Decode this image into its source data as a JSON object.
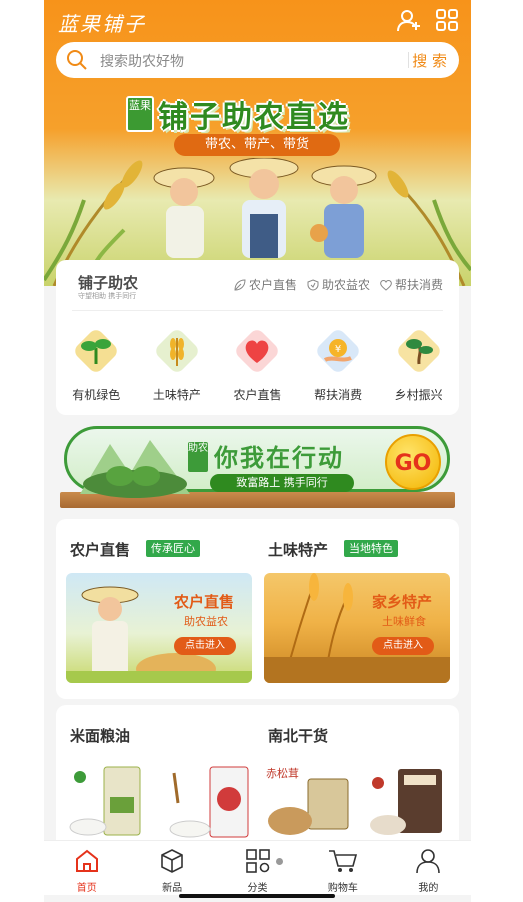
{
  "header": {
    "brand": "蓝果铺子",
    "icons": [
      "user-add-icon",
      "grid-icon"
    ]
  },
  "search": {
    "placeholder": "搜索助农好物",
    "button": "搜 索"
  },
  "banner": {
    "badge": "蓝果",
    "title": "铺子助农直选",
    "subtitle": "带农、带产、带货"
  },
  "intro": {
    "title": "铺子助农",
    "subtitle": "守望相助 携手同行",
    "tags": [
      "农户直售",
      "助农益农",
      "帮扶消费"
    ],
    "categories": [
      {
        "label": "有机绿色",
        "icon": "seedling-icon"
      },
      {
        "label": "土味特产",
        "icon": "wheat-icon"
      },
      {
        "label": "农户直售",
        "icon": "heart-icon"
      },
      {
        "label": "帮扶消费",
        "icon": "coin-icon"
      },
      {
        "label": "乡村振兴",
        "icon": "bonsai-icon"
      }
    ]
  },
  "promo": {
    "badge": "助农",
    "title": "你我在行动",
    "subtitle": "致富路上 携手同行",
    "go": "GO"
  },
  "sections": {
    "direct": {
      "title": "农户直售",
      "badge": "传承匠心",
      "card_title": "农户直售",
      "card_sub": "助农益农",
      "card_btn": "点击进入"
    },
    "local": {
      "title": "土味特产",
      "badge": "当地特色",
      "card_title": "家乡特产",
      "card_sub": "土味鲜食",
      "card_btn": "点击进入"
    },
    "grain": {
      "title": "米面粮油"
    },
    "dry": {
      "title": "南北干货"
    }
  },
  "tabbar": [
    {
      "label": "首页",
      "icon": "home-icon",
      "active": true
    },
    {
      "label": "新品",
      "icon": "cube-icon"
    },
    {
      "label": "分类",
      "icon": "category-icon"
    },
    {
      "label": "购物车",
      "icon": "cart-icon"
    },
    {
      "label": "我的",
      "icon": "person-icon"
    }
  ],
  "colors": {
    "orange": "#f7931a",
    "green": "#32a84a",
    "red": "#e5321b"
  }
}
